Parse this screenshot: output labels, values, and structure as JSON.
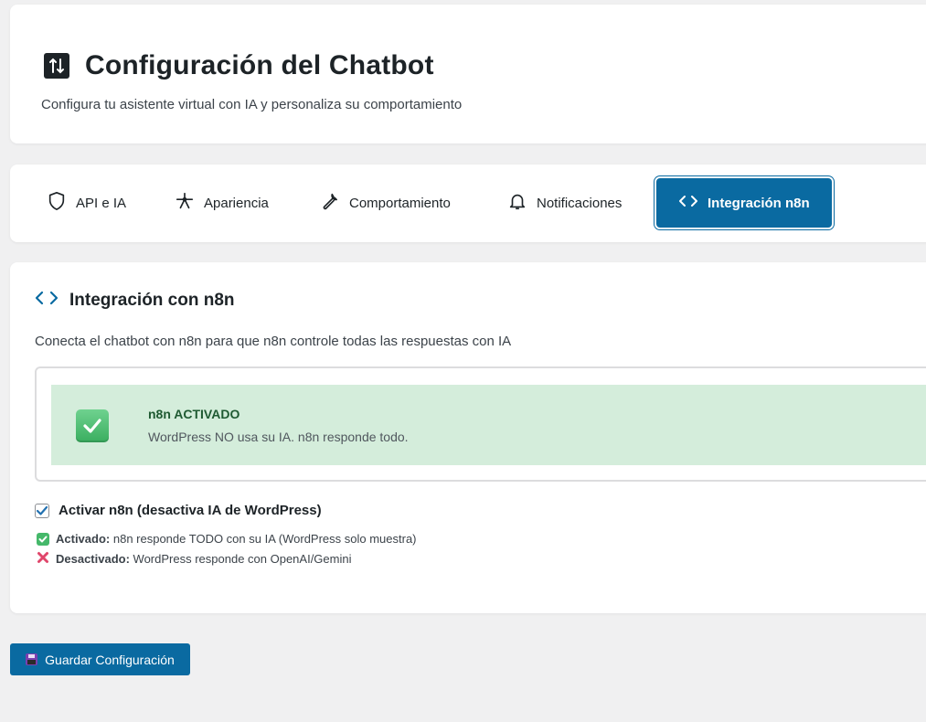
{
  "header": {
    "title": "Configuración del Chatbot",
    "subtitle": "Configura tu asistente virtual con IA y personaliza su comportamiento",
    "icon": "sliders-icon"
  },
  "tabs": [
    {
      "label": "API e IA",
      "icon": "shield-icon",
      "active": false
    },
    {
      "label": "Apariencia",
      "icon": "art-tool-icon",
      "active": false
    },
    {
      "label": "Comportamiento",
      "icon": "wrench-icon",
      "active": false
    },
    {
      "label": "Notificaciones",
      "icon": "bell-icon",
      "active": false
    },
    {
      "label": "Integración n8n",
      "icon": "code-icon",
      "active": true
    }
  ],
  "section": {
    "title": "Integración con n8n",
    "description": "Conecta el chatbot con n8n para que n8n controle todas las respuestas con IA",
    "icon": "code-icon"
  },
  "status": {
    "title": "n8n ACTIVADO",
    "text": "WordPress NO usa su IA. n8n responde todo."
  },
  "toggle": {
    "label": "Activar n8n (desactiva IA de WordPress)",
    "checked": true
  },
  "notes": {
    "on_label": "Activado:",
    "on_text": "n8n responde TODO con su IA (WordPress solo muestra)",
    "off_label": "Desactivado:",
    "off_text": "WordPress responde con OpenAI/Gemini"
  },
  "save_button": {
    "label": "Guardar Configuración",
    "icon": "floppy-disk-icon"
  },
  "colors": {
    "primary": "#0a6aa1",
    "success_bg": "#d4eddb",
    "success_text": "#1f5a32",
    "background": "#f0f0f1"
  }
}
